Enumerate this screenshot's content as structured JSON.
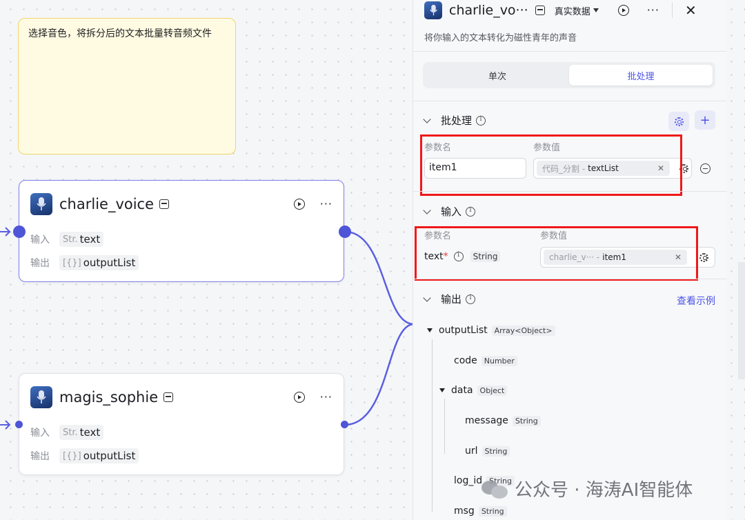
{
  "note": {
    "text": "选择音色，将拆分后的文本批量转音频文件"
  },
  "nodes": [
    {
      "title": "charlie_voice",
      "input_label": "输入",
      "input_type": "Str.",
      "input_value": "text",
      "output_label": "输出",
      "output_type": "[{}]",
      "output_value": "outputList"
    },
    {
      "title": "magis_sophie",
      "input_label": "输入",
      "input_type": "Str.",
      "input_value": "text",
      "output_label": "输出",
      "output_type": "[{}]",
      "output_value": "outputList"
    }
  ],
  "panel": {
    "title": "charlie_vo···",
    "mode": "真实数据",
    "description": "将你输入的文本转化为磁性青年的声音",
    "tabs": [
      {
        "label": "单次",
        "active": false
      },
      {
        "label": "批处理",
        "active": true
      }
    ],
    "batch": {
      "title": "批处理",
      "col_name": "参数名",
      "col_value": "参数值",
      "param_name": "item1",
      "ref_source": "代码_分割 -",
      "ref_field": "textList"
    },
    "input": {
      "title": "输入",
      "col_name": "参数名",
      "col_value": "参数值",
      "param_name": "text",
      "required_mark": "*",
      "param_type": "String",
      "ref_source": "charlie_v··· -",
      "ref_field": "item1"
    },
    "output": {
      "title": "输出",
      "link": "查看示例",
      "tree": [
        {
          "name": "outputList",
          "type": "Array<Object>"
        },
        {
          "name": "code",
          "type": "Number"
        },
        {
          "name": "data",
          "type": "Object"
        },
        {
          "name": "message",
          "type": "String"
        },
        {
          "name": "url",
          "type": "String"
        },
        {
          "name": "log_id",
          "type": "String"
        },
        {
          "name": "msg",
          "type": "String"
        }
      ]
    }
  },
  "watermark": "公众号 · 海涛AI智能体",
  "colors": {
    "accent": "#4d53e8",
    "port": "#4e55d6",
    "highlight": "#f01818",
    "note_bg": "#fffbe3"
  }
}
